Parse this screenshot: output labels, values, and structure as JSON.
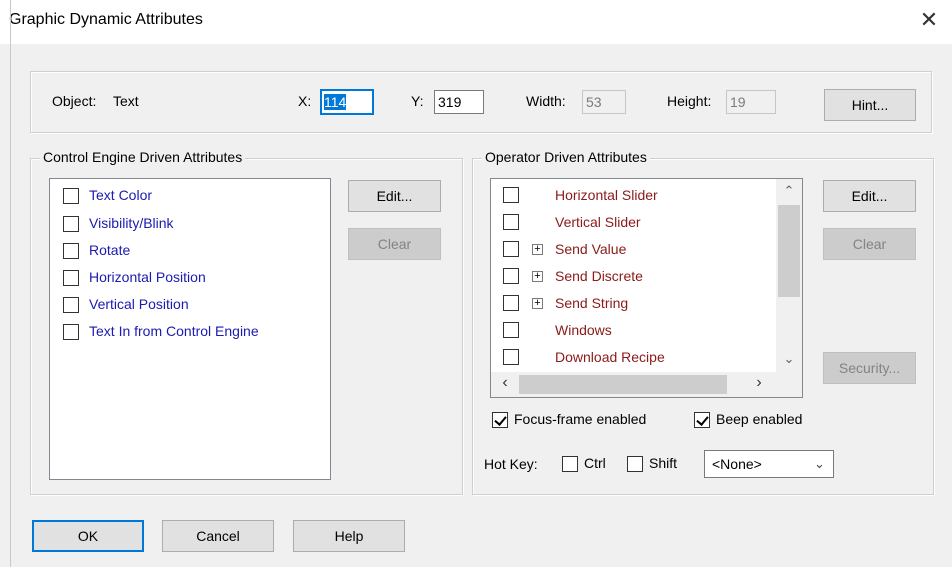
{
  "window": {
    "title": "Graphic Dynamic Attributes",
    "close_glyph": "✕"
  },
  "object": {
    "label": "Object:",
    "value": "Text",
    "x_label": "X:",
    "x_value": "114",
    "y_label": "Y:",
    "y_value": "319",
    "width_label": "Width:",
    "width_value": "53",
    "height_label": "Height:",
    "height_value": "19",
    "hint_button": "Hint..."
  },
  "control_engine": {
    "legend": "Control Engine Driven Attributes",
    "items": [
      {
        "label": "Text Color",
        "checked": false
      },
      {
        "label": "Visibility/Blink",
        "checked": false
      },
      {
        "label": "Rotate",
        "checked": false
      },
      {
        "label": "Horizontal Position",
        "checked": false
      },
      {
        "label": "Vertical Position",
        "checked": false
      },
      {
        "label": "Text In from Control Engine",
        "checked": false
      }
    ],
    "edit_button": "Edit...",
    "clear_button": "Clear"
  },
  "operator": {
    "legend": "Operator Driven Attributes",
    "items": [
      {
        "label": "Horizontal Slider",
        "expandable": false,
        "checked": false
      },
      {
        "label": "Vertical Slider",
        "expandable": false,
        "checked": false
      },
      {
        "label": "Send Value",
        "expandable": true,
        "checked": false
      },
      {
        "label": "Send Discrete",
        "expandable": true,
        "checked": false
      },
      {
        "label": "Send String",
        "expandable": true,
        "checked": false
      },
      {
        "label": "Windows",
        "expandable": false,
        "checked": false
      },
      {
        "label": "Download Recipe",
        "expandable": false,
        "checked": false
      }
    ],
    "edit_button": "Edit...",
    "clear_button": "Clear",
    "security_button": "Security...",
    "focus_frame_label": "Focus-frame enabled",
    "focus_frame_checked": true,
    "beep_label": "Beep enabled",
    "beep_checked": true,
    "hotkey_label": "Hot Key:",
    "ctrl_label": "Ctrl",
    "ctrl_checked": false,
    "shift_label": "Shift",
    "shift_checked": false,
    "key_value": "<None>"
  },
  "footer": {
    "ok": "OK",
    "cancel": "Cancel",
    "help": "Help"
  },
  "colors": {
    "accent": "#0078d7",
    "control_item_text": "#1b1bb0",
    "operator_item_text": "#8b1a1a"
  }
}
